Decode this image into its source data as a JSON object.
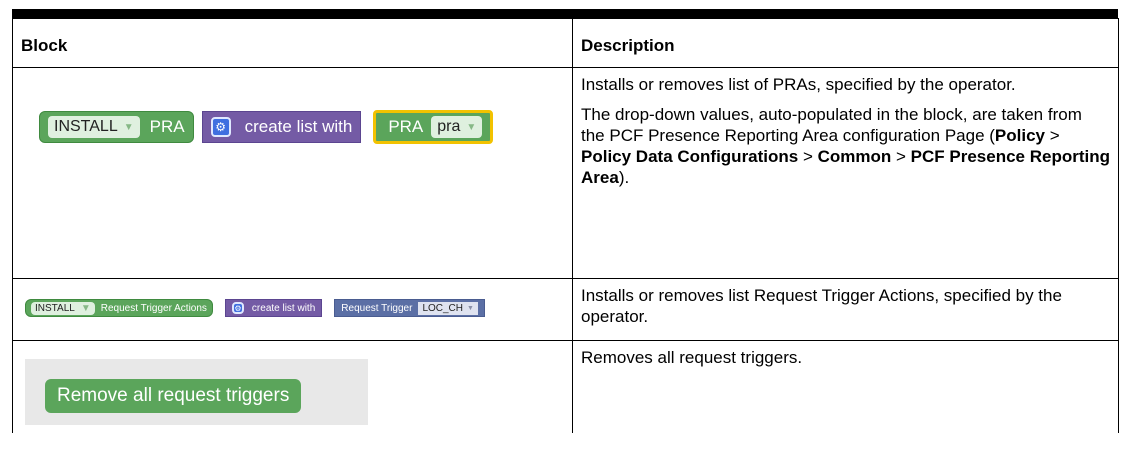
{
  "table": {
    "headers": [
      "Block",
      "Description"
    ],
    "rows": [
      {
        "block": {
          "action": "INSTALL",
          "label": "PRA",
          "list_label": "create list with",
          "item_label": "PRA",
          "item_value": "pra"
        },
        "description": {
          "p1": "Installs or removes list of PRAs, specified by the operator.",
          "p2_intro": "The drop-down values, auto-populated in the block, are taken from the PCF Presence Reporting Area configuration Page (",
          "path": [
            "Policy",
            "Policy Data Configurations",
            "Common",
            "PCF Presence Reporting Area"
          ],
          "separator": " > ",
          "p2_end": ")."
        }
      },
      {
        "block": {
          "action": "INSTALL",
          "label": "Request Trigger Actions",
          "list_label": "create list with",
          "item_label": "Request Trigger",
          "item_value": "LOC_CH"
        },
        "description": {
          "p1": "Installs or removes list Request Trigger Actions, specified by the operator."
        }
      },
      {
        "block": {
          "label": "Remove all request triggers"
        },
        "description": {
          "p1": "Removes all request triggers."
        }
      }
    ]
  },
  "icons": {
    "gear": "gear-icon",
    "dropdown": "dropdown-arrow-icon"
  },
  "colors": {
    "block_green": "#5ba55b",
    "block_purple": "#745ba5",
    "block_blue": "#5b6fa5",
    "highlight_yellow": "#f2c200"
  }
}
